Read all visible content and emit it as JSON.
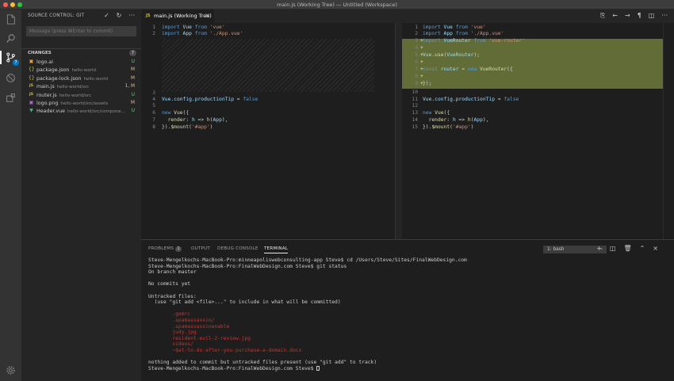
{
  "window": {
    "title": "main.js (Working Tree) — Untitled (Workspace)",
    "traffic_colors": [
      "#fe5f57",
      "#febc2e",
      "#28c840"
    ]
  },
  "activity_bar": {
    "icons": [
      "files-icon",
      "search-icon",
      "source-control-icon",
      "debug-icon",
      "extensions-icon",
      "gear-icon"
    ],
    "scm_badge": "7"
  },
  "sidebar": {
    "title": "SOURCE CONTROL: GIT",
    "commit_placeholder": "Message (press ⌘Enter to commit)",
    "changes_label": "CHANGES",
    "changes_count": "7",
    "files": [
      {
        "name": "logo.ai",
        "path": "",
        "status": "U",
        "icon": "image-file-icon",
        "status_color": "#73c991",
        "icon_color": "#e8a33d",
        "glyph": "▣"
      },
      {
        "name": "package.json",
        "path": "hello-world",
        "status": "M",
        "icon": "json-file-icon",
        "status_color": "#e2c08d",
        "icon_color": "#d4c33a",
        "glyph": "{}"
      },
      {
        "name": "package-lock.json",
        "path": "hello-world",
        "status": "M",
        "icon": "json-file-icon",
        "status_color": "#e2c08d",
        "icon_color": "#d4c33a",
        "glyph": "{}"
      },
      {
        "name": "main.js",
        "path": "hello-world/src",
        "status": "1, M",
        "icon": "js-file-icon",
        "status_color": "#e2c08d",
        "icon_color": "#d4c33a",
        "glyph": "JS"
      },
      {
        "name": "router.js",
        "path": "hello-world/src",
        "status": "U",
        "icon": "js-file-icon",
        "status_color": "#73c991",
        "icon_color": "#d4c33a",
        "glyph": "JS"
      },
      {
        "name": "logo.png",
        "path": "hello-world/src/assets",
        "status": "M",
        "icon": "image-file-icon",
        "status_color": "#e2c08d",
        "icon_color": "#a074c4",
        "glyph": "▣"
      },
      {
        "name": "Header.vue",
        "path": "hello-world/src/compone...",
        "status": "U",
        "icon": "vue-file-icon",
        "status_color": "#73c991",
        "icon_color": "#41b883",
        "glyph": "▼"
      }
    ]
  },
  "editor": {
    "tab_label": "main.js (Working Tree)",
    "tab_icon_text": "JS",
    "left": {
      "lines": [
        {
          "n": "1",
          "tokens": [
            [
              "kw",
              "import "
            ],
            [
              "id",
              "Vue "
            ],
            [
              "kw",
              "from "
            ],
            [
              "str",
              "'vue'"
            ]
          ]
        },
        {
          "n": "2",
          "tokens": [
            [
              "kw",
              "import "
            ],
            [
              "id",
              "App "
            ],
            [
              "kw",
              "from "
            ],
            [
              "str",
              "'./App.vue'"
            ]
          ]
        },
        {
          "n": "3",
          "tokens": []
        },
        {
          "n": "4",
          "tokens": [
            [
              "id",
              "Vue"
            ],
            [
              "plain",
              "."
            ],
            [
              "id",
              "config"
            ],
            [
              "plain",
              "."
            ],
            [
              "id",
              "productionTip"
            ],
            [
              "plain",
              " = "
            ],
            [
              "kw",
              "false"
            ]
          ]
        },
        {
          "n": "5",
          "tokens": []
        },
        {
          "n": "6",
          "tokens": [
            [
              "kw",
              "new "
            ],
            [
              "fn",
              "Vue"
            ],
            [
              "plain",
              "({"
            ]
          ]
        },
        {
          "n": "7",
          "tokens": [
            [
              "plain",
              "  "
            ],
            [
              "fn",
              "render"
            ],
            [
              "plain",
              ": "
            ],
            [
              "id",
              "h"
            ],
            [
              "plain",
              " => "
            ],
            [
              "fn",
              "h"
            ],
            [
              "plain",
              "("
            ],
            [
              "id",
              "App"
            ],
            [
              "plain",
              "),"
            ]
          ]
        },
        {
          "n": "8",
          "tokens": [
            [
              "plain",
              "})."
            ],
            [
              "fn",
              "$mount"
            ],
            [
              "plain",
              "("
            ],
            [
              "str",
              "'#app'"
            ],
            [
              "plain",
              ")"
            ]
          ]
        }
      ]
    },
    "right": {
      "lines": [
        {
          "n": "1",
          "plus": "",
          "tokens": [
            [
              "kw",
              "import "
            ],
            [
              "id",
              "Vue "
            ],
            [
              "kw",
              "from "
            ],
            [
              "str",
              "'vue'"
            ]
          ]
        },
        {
          "n": "2",
          "plus": "",
          "tokens": [
            [
              "kw",
              "import "
            ],
            [
              "id",
              "App "
            ],
            [
              "kw",
              "from "
            ],
            [
              "str",
              "'./App.vue'"
            ]
          ]
        },
        {
          "n": "3",
          "plus": "+",
          "tokens": [
            [
              "kw",
              "import "
            ],
            [
              "id",
              "VueRouter "
            ],
            [
              "kw",
              "from "
            ],
            [
              "str",
              "'vue-router'"
            ]
          ]
        },
        {
          "n": "4",
          "plus": "+",
          "tokens": []
        },
        {
          "n": "5",
          "plus": "+",
          "tokens": [
            [
              "id",
              "Vue"
            ],
            [
              "plain",
              "."
            ],
            [
              "fn",
              "use"
            ],
            [
              "plain",
              "("
            ],
            [
              "id",
              "VueRouter"
            ],
            [
              "plain",
              ");"
            ]
          ]
        },
        {
          "n": "6",
          "plus": "+",
          "tokens": []
        },
        {
          "n": "7",
          "plus": "+",
          "tokens": [
            [
              "kw",
              "const "
            ],
            [
              "id",
              "router"
            ],
            [
              "plain",
              " = "
            ],
            [
              "kw",
              "new "
            ],
            [
              "fn",
              "VueRouter"
            ],
            [
              "plain",
              "({"
            ]
          ]
        },
        {
          "n": "8",
          "plus": "+",
          "tokens": []
        },
        {
          "n": "9",
          "plus": "+",
          "tokens": [
            [
              "plain",
              "});"
            ]
          ]
        },
        {
          "n": "10",
          "plus": "",
          "tokens": []
        },
        {
          "n": "11",
          "plus": "",
          "tokens": [
            [
              "id",
              "Vue"
            ],
            [
              "plain",
              "."
            ],
            [
              "id",
              "config"
            ],
            [
              "plain",
              "."
            ],
            [
              "id",
              "productionTip"
            ],
            [
              "plain",
              " = "
            ],
            [
              "kw",
              "false"
            ]
          ]
        },
        {
          "n": "12",
          "plus": "",
          "tokens": []
        },
        {
          "n": "13",
          "plus": "",
          "tokens": [
            [
              "kw",
              "new "
            ],
            [
              "fn",
              "Vue"
            ],
            [
              "plain",
              "({"
            ]
          ]
        },
        {
          "n": "14",
          "plus": "",
          "tokens": [
            [
              "plain",
              "  "
            ],
            [
              "fn",
              "render"
            ],
            [
              "plain",
              ": "
            ],
            [
              "id",
              "h"
            ],
            [
              "plain",
              " => "
            ],
            [
              "fn",
              "h"
            ],
            [
              "plain",
              "("
            ],
            [
              "id",
              "App"
            ],
            [
              "plain",
              "),"
            ]
          ]
        },
        {
          "n": "15",
          "plus": "",
          "tokens": [
            [
              "plain",
              "})."
            ],
            [
              "fn",
              "$mount"
            ],
            [
              "plain",
              "("
            ],
            [
              "str",
              "'#app'"
            ],
            [
              "plain",
              ")"
            ]
          ]
        }
      ]
    }
  },
  "panel": {
    "tabs": {
      "problems": "PROBLEMS",
      "problems_count": "1",
      "output": "OUTPUT",
      "debug_console": "DEBUG CONSOLE",
      "terminal": "TERMINAL"
    },
    "terminal_select": "1: bash",
    "terminal_lines": [
      {
        "cls": "",
        "text": "Steve-Mengelkochs-MacBook-Pro:minneapoliswebconsulting-app Steve$ cd /Users/Steve/Sites/FinalWebDesign.com"
      },
      {
        "cls": "",
        "text": "Steve-Mengelkochs-MacBook-Pro:FinalWebDesign.com Steve$ git status"
      },
      {
        "cls": "",
        "text": "On branch master"
      },
      {
        "cls": "",
        "text": ""
      },
      {
        "cls": "",
        "text": "No commits yet"
      },
      {
        "cls": "",
        "text": ""
      },
      {
        "cls": "",
        "text": "Untracked files:"
      },
      {
        "cls": "",
        "text": "  (use \"git add <file>...\" to include in what will be committed)"
      },
      {
        "cls": "",
        "text": ""
      },
      {
        "cls": "red",
        "text": "        .gemrc"
      },
      {
        "cls": "red",
        "text": "        .spamassassin/"
      },
      {
        "cls": "red",
        "text": "        .spamassassinenable"
      },
      {
        "cls": "red",
        "text": "        judy.jpg"
      },
      {
        "cls": "red",
        "text": "        resident-evil-2-review.jpg"
      },
      {
        "cls": "red",
        "text": "        videos/"
      },
      {
        "cls": "red",
        "text": "        ~$at-to-do-after-you-purchase-a-domain.docx"
      },
      {
        "cls": "",
        "text": ""
      },
      {
        "cls": "",
        "text": "nothing added to commit but untracked files present (use \"git add\" to track)"
      },
      {
        "cls": "",
        "text": "Steve-Mengelkochs-MacBook-Pro:FinalWebDesign.com Steve$ "
      }
    ]
  }
}
